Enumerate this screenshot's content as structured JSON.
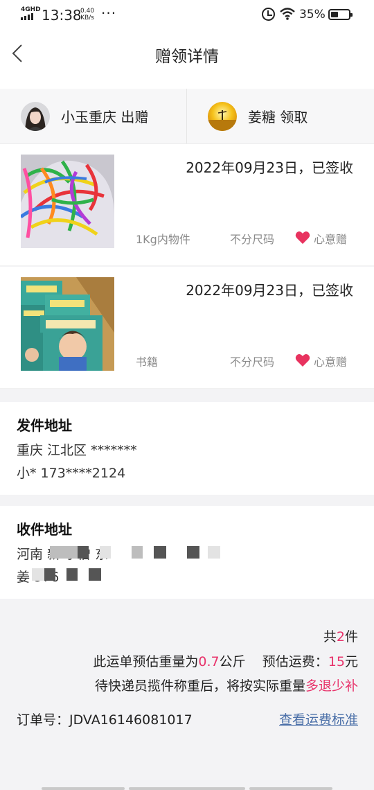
{
  "status_bar": {
    "network": "4GHD",
    "time": "13:38",
    "speed_value": "0.40",
    "speed_unit": "KB/s",
    "more": "···",
    "battery": "35%"
  },
  "nav": {
    "title": "赠领详情",
    "back_icon": "back-arrow-icon"
  },
  "users": {
    "giver": "小玉重庆 出赠",
    "receiver": "姜糖 领取"
  },
  "items": [
    {
      "date_status": "2022年09月23日，已签收",
      "category": "1Kg内物件",
      "size": "不分尺码",
      "type": "心意赠"
    },
    {
      "date_status": "2022年09月23日，已签收",
      "category": "书籍",
      "size": "不分尺码",
      "type": "心意赠"
    }
  ],
  "send_address": {
    "title": "发件地址",
    "line1": "重庆 江北区 *******",
    "line2": "小* 173****2124"
  },
  "receive_address": {
    "title": "收件地址",
    "line1": "河南 新 学僧 东",
    "line2": "姜 976"
  },
  "summary": {
    "count_prefix": "共",
    "count": "2",
    "count_suffix": "件",
    "weight_prefix": "此运单预估重量为",
    "weight": "0.7",
    "weight_unit": "公斤",
    "fee_label": "预估运费：",
    "fee": "15",
    "fee_unit": "元",
    "note_prefix": "待快递员揽件称重后，将按实际重量",
    "note_highlight": "多退少补",
    "order_label": "订单号：",
    "order_number": "JDVA16146081017",
    "fee_link": "查看运费标准"
  },
  "colors": {
    "accent_red": "#e8336b",
    "link_blue": "#4a6fa8",
    "heart": "#e8335f"
  }
}
